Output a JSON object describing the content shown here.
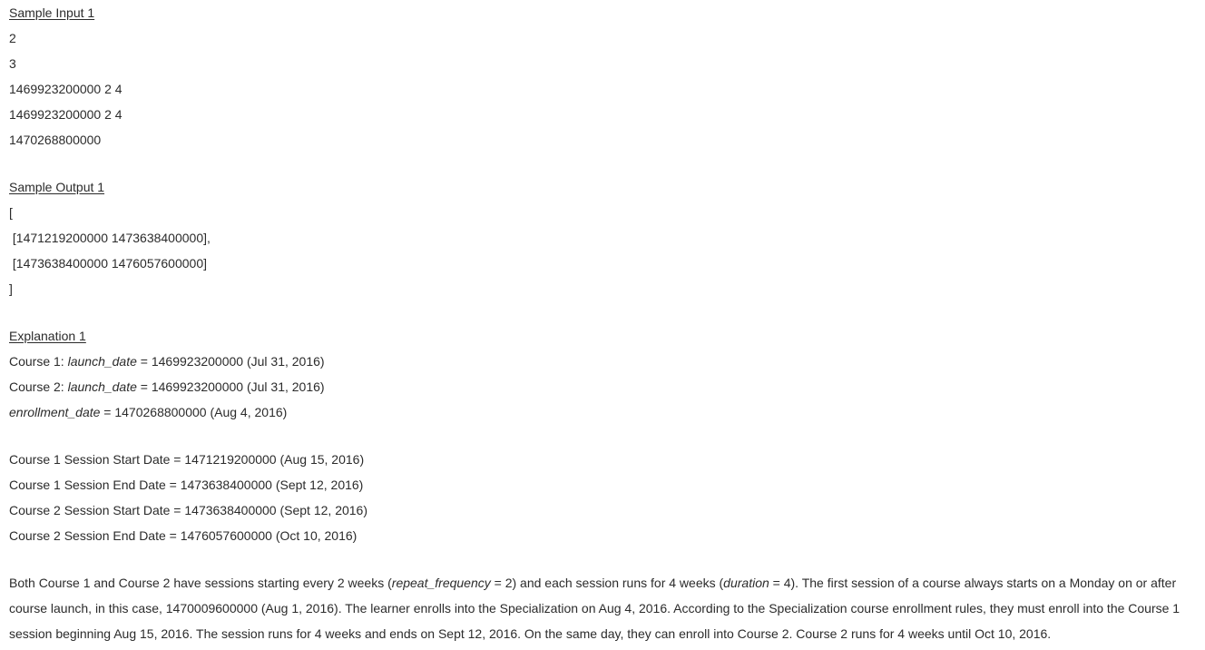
{
  "sample_input": {
    "heading": "Sample Input 1",
    "lines": [
      "2",
      "3",
      "1469923200000 2 4",
      "1469923200000 2 4",
      "1470268800000"
    ]
  },
  "sample_output": {
    "heading": "Sample Output 1",
    "lines": [
      "[",
      " [1471219200000 1473638400000],",
      " [1473638400000 1476057600000]",
      "]"
    ]
  },
  "explanation": {
    "heading": "Explanation 1",
    "course1_prefix": "Course 1: ",
    "course1_var": "launch_date",
    "course1_rest": " = 1469923200000 (Jul 31, 2016)",
    "course2_prefix": "Course 2: ",
    "course2_var": "launch_date",
    "course2_rest": " = 1469923200000 (Jul 31, 2016)",
    "enroll_var": "enrollment_date",
    "enroll_rest": " = 1470268800000 (Aug 4, 2016)",
    "sessions": [
      "Course 1 Session Start Date = 1471219200000 (Aug 15, 2016)",
      "Course 1 Session End Date = 1473638400000 (Sept 12, 2016)",
      "Course 2 Session Start Date = 1473638400000 (Sept 12, 2016)",
      "Course 2 Session End Date = 1476057600000 (Oct 10, 2016)"
    ],
    "para_part1": "Both Course 1 and Course 2 have sessions starting every 2 weeks (",
    "para_var1": "repeat_frequency",
    "para_part2": " = 2) and each session runs for 4 weeks (",
    "para_var2": "duration",
    "para_part3": " = 4). The first session of a course always starts on a Monday on or after course launch, in this case, 1470009600000 (Aug 1, 2016). The learner enrolls into the Specialization on Aug 4, 2016. According to the Specialization course enrollment rules, they must enroll into the Course 1 session beginning Aug 15, 2016. The session runs for 4 weeks and ends on Sept 12, 2016. On the same day, they can enroll into Course 2. Course 2 runs for 4 weeks until Oct 10, 2016."
  }
}
